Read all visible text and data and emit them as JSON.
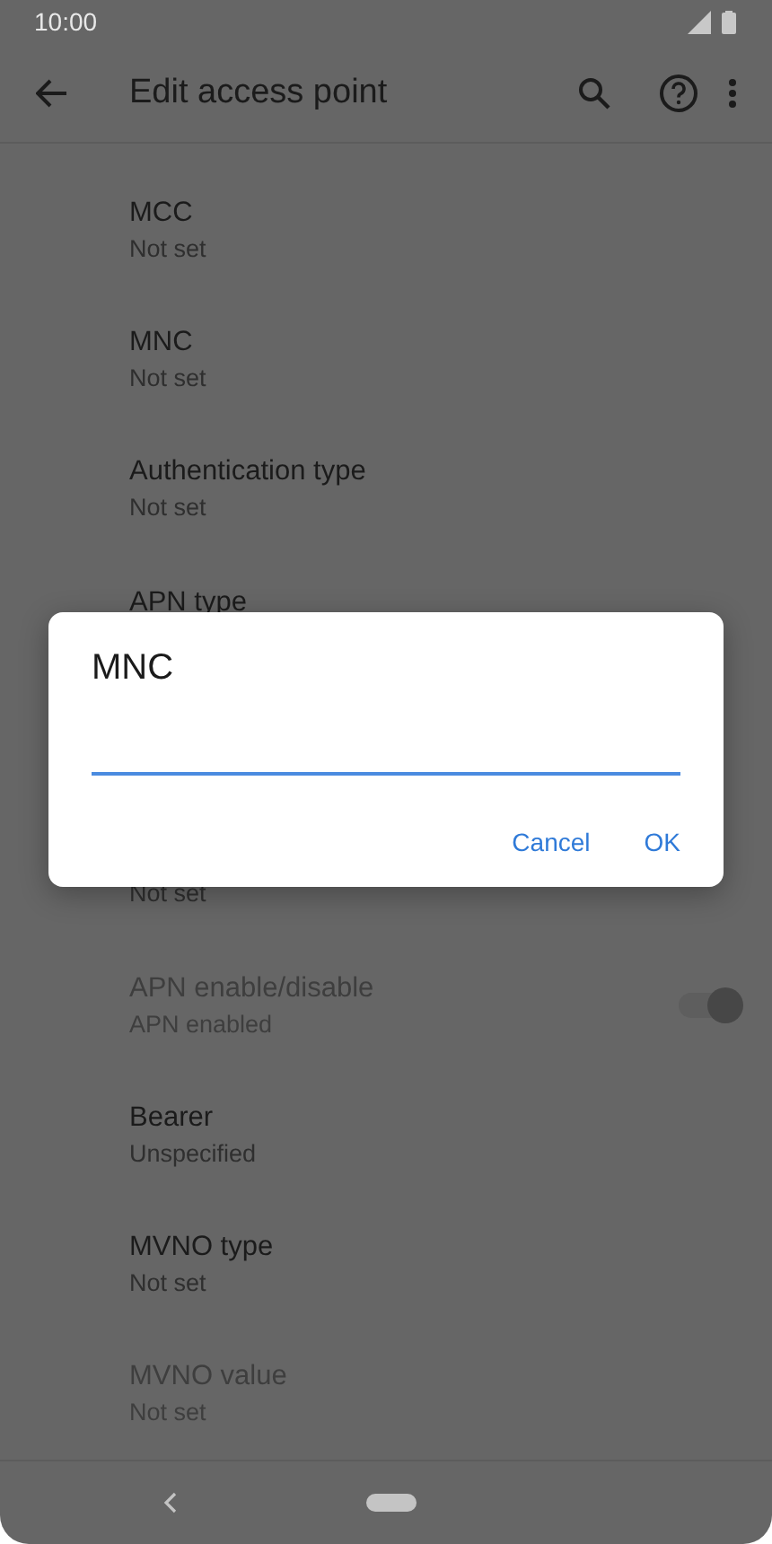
{
  "status_bar": {
    "time": "10:00"
  },
  "toolbar": {
    "title": "Edit access point"
  },
  "items": [
    {
      "kind": "text",
      "title": "MCC",
      "subtitle": "Not set",
      "disabled": false
    },
    {
      "kind": "text",
      "title": "MNC",
      "subtitle": "Not set",
      "disabled": false
    },
    {
      "kind": "text",
      "title": "Authentication type",
      "subtitle": "Not set",
      "disabled": false
    },
    {
      "kind": "title_only",
      "title": "APN type",
      "disabled": false
    },
    {
      "kind": "covered",
      "subtitle": "Not set",
      "disabled": false
    },
    {
      "kind": "switch",
      "title": "APN enable/disable",
      "subtitle": "APN enabled",
      "disabled": true,
      "on": true
    },
    {
      "kind": "text",
      "title": "Bearer",
      "subtitle": "Unspecified",
      "disabled": false
    },
    {
      "kind": "text",
      "title": "MVNO type",
      "subtitle": "Not set",
      "disabled": false
    },
    {
      "kind": "text",
      "title": "MVNO value",
      "subtitle": "Not set",
      "disabled": true
    }
  ],
  "dialog": {
    "title": "MNC",
    "buttons": [
      "Cancel",
      "OK"
    ]
  }
}
